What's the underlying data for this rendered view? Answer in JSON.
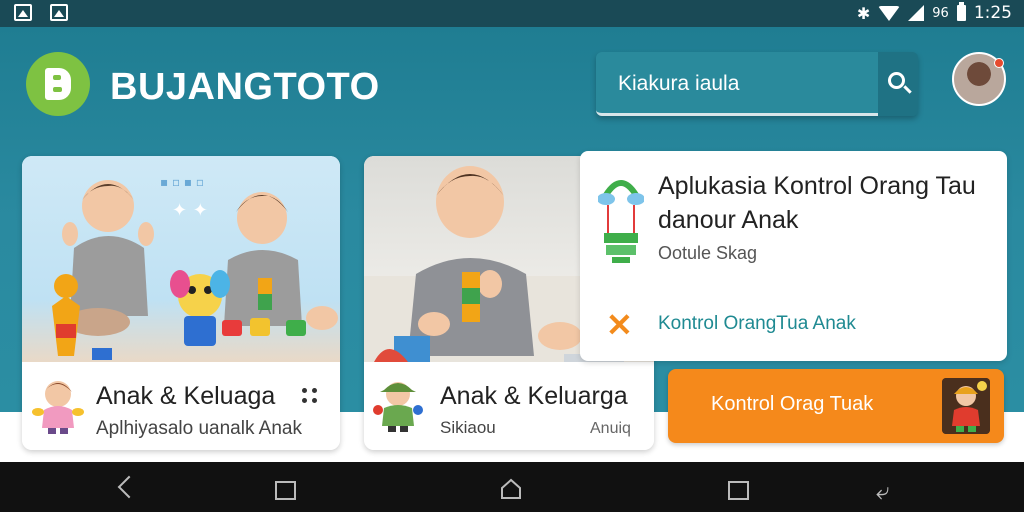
{
  "status_bar": {
    "network_label": "96",
    "time": "1:25"
  },
  "header": {
    "app_title": "BUJANGTOTO",
    "search_value": "Kiakura iaula"
  },
  "cards": [
    {
      "title": "Anak & Keluaga",
      "subtitle": "Aplhiyasalo uanalk Anak"
    },
    {
      "title": "Anak & Keluarga",
      "subtitle_left": "Sikiaou",
      "subtitle_right": "Anuiq"
    }
  ],
  "panel": {
    "title": "Aplukasia Kontrol Orang Tau danour Anak",
    "subtitle": "Ootule Skag",
    "link": "Kontrol OrangTua Anak"
  },
  "cta": {
    "label": "Kontrol Orag Tuak"
  },
  "colors": {
    "header_bg": "#2a8aa0",
    "logo_green": "#7ec242",
    "cta_orange": "#f5891b",
    "link_teal": "#1f8a92"
  },
  "icons": [
    "image-icon",
    "bluetooth-icon",
    "wifi-icon",
    "signal-icon",
    "battery-icon",
    "search-icon",
    "more-icon",
    "balloon-icon",
    "close-icon",
    "back-icon",
    "home-icon",
    "recents-icon"
  ]
}
